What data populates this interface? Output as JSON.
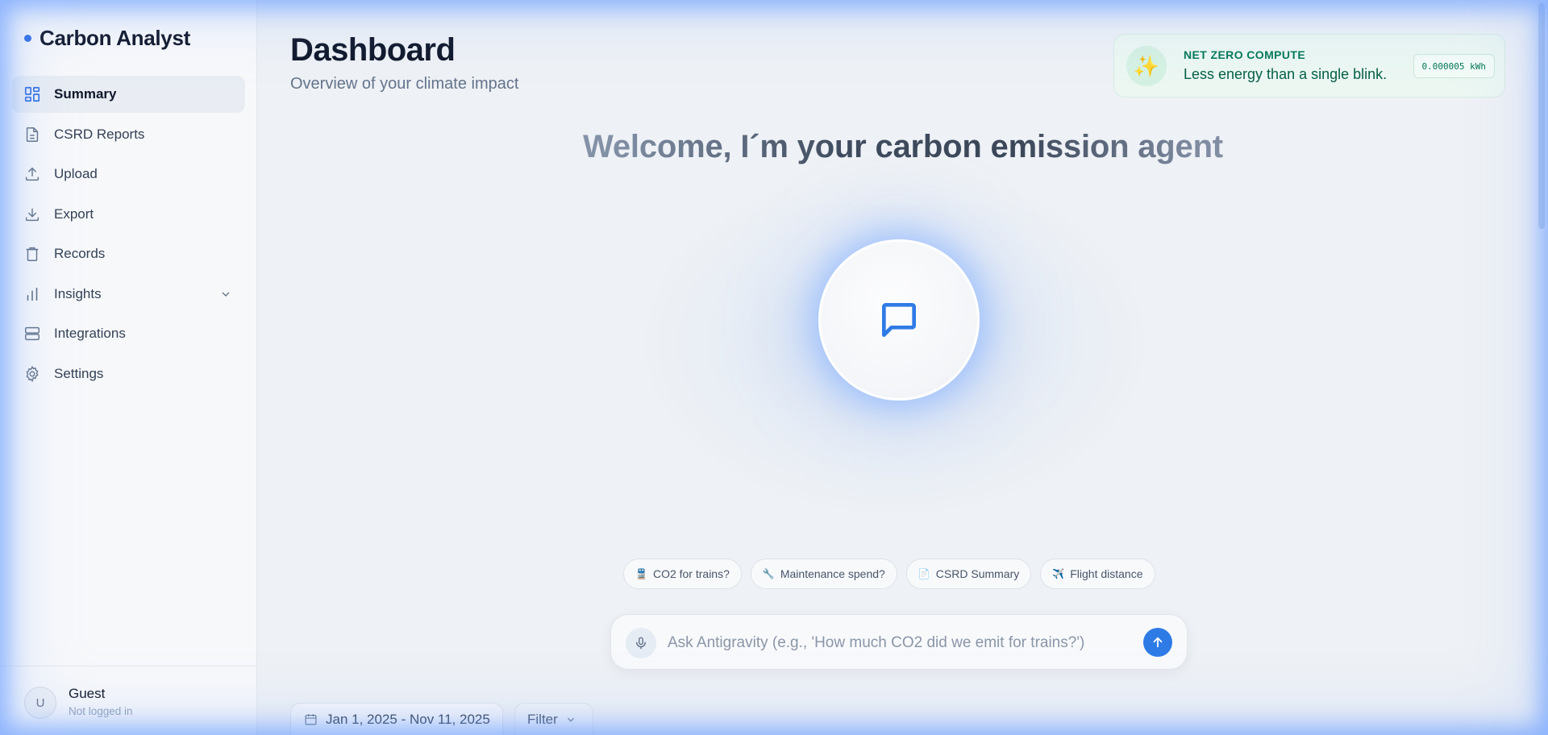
{
  "brand": {
    "name": "Carbon Analyst"
  },
  "sidebar": {
    "items": [
      {
        "label": "Summary",
        "icon": "grid-icon",
        "active": true
      },
      {
        "label": "CSRD Reports",
        "icon": "document-icon"
      },
      {
        "label": "Upload",
        "icon": "upload-icon"
      },
      {
        "label": "Export",
        "icon": "download-icon"
      },
      {
        "label": "Records",
        "icon": "trash-icon"
      },
      {
        "label": "Insights",
        "icon": "bar-chart-icon",
        "expandable": true
      },
      {
        "label": "Integrations",
        "icon": "server-icon"
      },
      {
        "label": "Settings",
        "icon": "gear-icon"
      }
    ],
    "user": {
      "initial": "U",
      "name": "Guest",
      "status": "Not logged in"
    }
  },
  "header": {
    "title": "Dashboard",
    "subtitle": "Overview of your climate impact"
  },
  "net_zero": {
    "heading": "NET ZERO COMPUTE",
    "text": "Less energy than a single blink.",
    "badge": "0.000005 kWh",
    "icon": "sparkles-icon"
  },
  "welcome": "Welcome, I´m your carbon emission agent",
  "suggestions": [
    {
      "emoji": "🚆",
      "label": "CO2 for trains?"
    },
    {
      "emoji": "🔧",
      "label": "Maintenance spend?"
    },
    {
      "emoji": "📄",
      "label": "CSRD Summary"
    },
    {
      "emoji": "✈️",
      "label": "Flight distance"
    }
  ],
  "ask": {
    "placeholder": "Ask Antigravity (e.g., 'How much CO2 did we emit for trains?')",
    "value": ""
  },
  "toolbar": {
    "date_range": "Jan 1, 2025 - Nov 11, 2025",
    "filter_label": "Filter"
  },
  "colors": {
    "accent": "#2f7be6",
    "brand_dot": "#2f6fe4",
    "success_text": "#047857",
    "glow": "#6096ff"
  }
}
